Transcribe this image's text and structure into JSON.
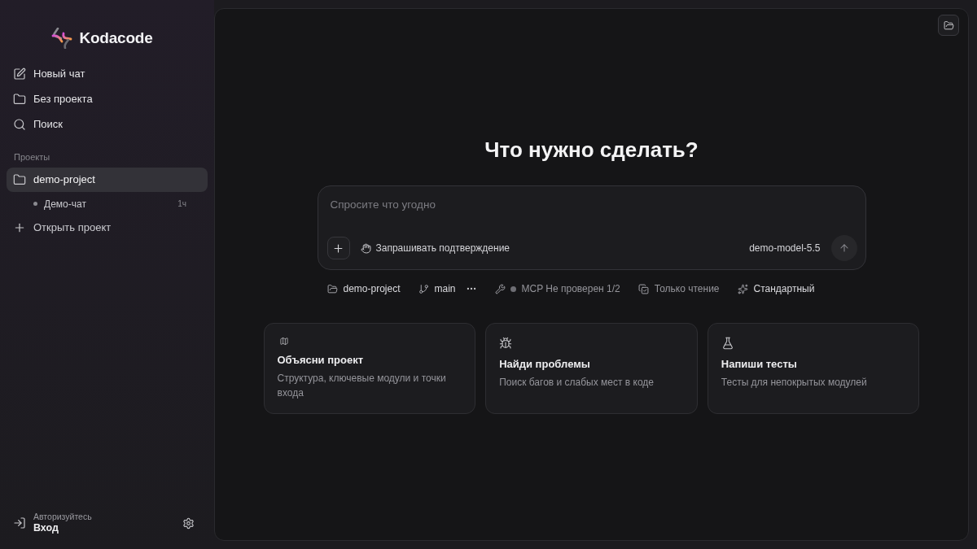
{
  "sidebar": {
    "brand": "Kodacode",
    "nav": [
      {
        "kind": "new-chat",
        "label": "Новый чат"
      },
      {
        "kind": "no-project",
        "label": "Без проекта"
      },
      {
        "kind": "search",
        "label": "Поиск"
      }
    ],
    "projects_heading": "Проекты",
    "projects": [
      {
        "label": "demo-project",
        "selected": true,
        "children": [
          {
            "label": "Демо-чат",
            "time": "1ч",
            "selected": false
          }
        ]
      }
    ],
    "open_project": "Открыть проект",
    "account": {
      "hint": "Авторизуйтесь",
      "action": "Вход"
    }
  },
  "main": {
    "title": "Что нужно сделать?",
    "composer": {
      "placeholder": "Спросите что угодно",
      "approval": "Запрашивать подтверждение",
      "model": "demo-model-5.5"
    },
    "status": [
      {
        "kind": "project",
        "label": "demo-project",
        "muted": false
      },
      {
        "kind": "branch",
        "label": "main",
        "muted": false
      },
      {
        "kind": "more"
      },
      {
        "kind": "mcp",
        "label": "MCP Не проверен 1/2",
        "muted": true
      },
      {
        "kind": "readonly",
        "label": "Только чтение",
        "muted": true
      },
      {
        "kind": "mode",
        "label": "Стандартный",
        "muted": false
      }
    ],
    "suggestions": [
      {
        "kind": "map",
        "title": "Объясни проект",
        "description": "Структура, ключевые модули и точки входа"
      },
      {
        "kind": "bug",
        "title": "Найди проблемы",
        "description": "Поиск багов и слабых мест в коде"
      },
      {
        "kind": "flask",
        "title": "Напиши тесты",
        "description": "Тесты для непокрытых модулей"
      }
    ]
  }
}
